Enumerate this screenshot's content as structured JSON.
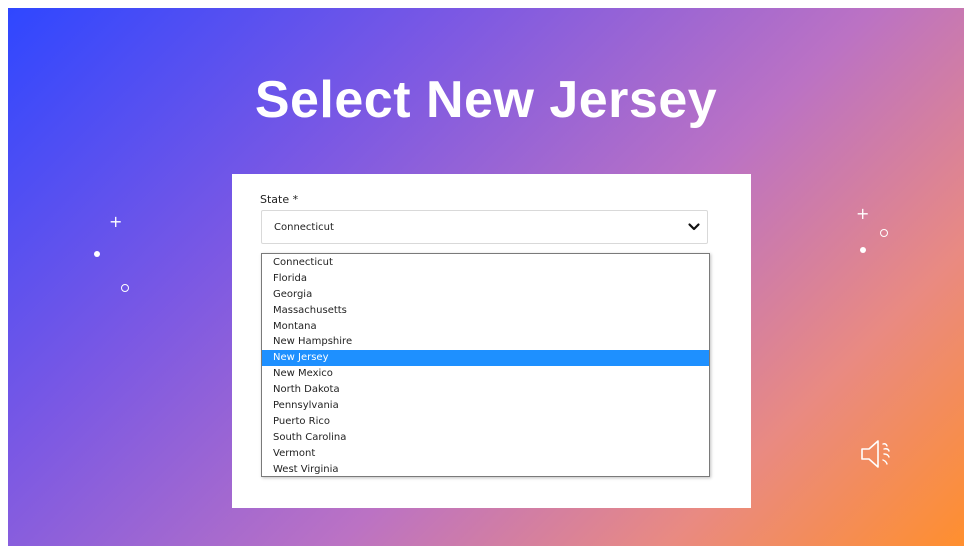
{
  "slide": {
    "title": "Select New Jersey"
  },
  "form": {
    "state_label": "State *",
    "selected_value": "Connecticut",
    "highlighted_option": "New Jersey",
    "options": [
      "Connecticut",
      "Florida",
      "Georgia",
      "Massachusetts",
      "Montana",
      "New Hampshire",
      "New Jersey",
      "New Mexico",
      "North Dakota",
      "Pennsylvania",
      "Puerto Rico",
      "South Carolina",
      "Vermont",
      "West Virginia"
    ]
  },
  "icons": {
    "dropdown": "chevron-down-icon",
    "audio": "speaker-icon"
  },
  "colors": {
    "gradient_start": "#2f47ff",
    "gradient_end": "#ff8f2e",
    "highlight": "#1e90ff"
  }
}
